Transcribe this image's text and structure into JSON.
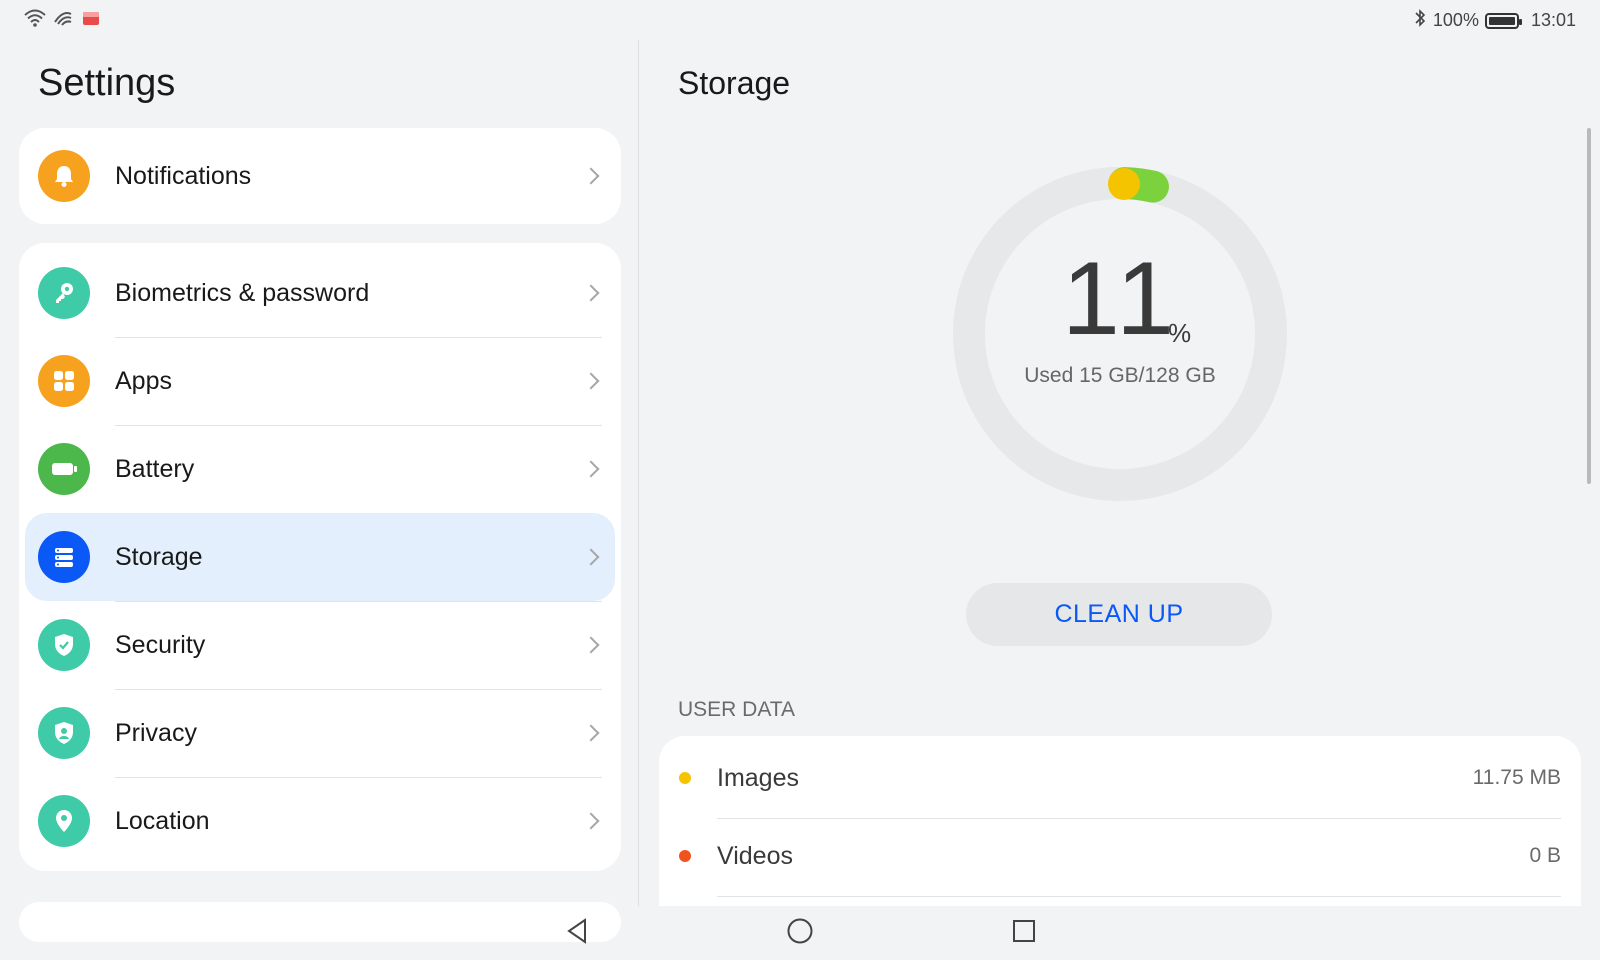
{
  "status_bar": {
    "battery_percent": "100%",
    "time": "13:01",
    "icons": [
      "wifi-icon",
      "signal-icon",
      "app-notification-icon",
      "bluetooth-icon",
      "battery-icon"
    ]
  },
  "settings": {
    "title": "Settings",
    "notifications": {
      "label": "Notifications",
      "icon": "bell-icon",
      "color": "#f7a21e"
    },
    "items": [
      {
        "label": "Biometrics & password",
        "icon": "key-icon",
        "color": "#3fcba8"
      },
      {
        "label": "Apps",
        "icon": "apps-grid-icon",
        "color": "#f7a21e"
      },
      {
        "label": "Battery",
        "icon": "battery-icon",
        "color": "#4cb84c"
      },
      {
        "label": "Storage",
        "icon": "storage-icon",
        "color": "#0a59f7"
      },
      {
        "label": "Security",
        "icon": "shield-check-icon",
        "color": "#3fcba8"
      },
      {
        "label": "Privacy",
        "icon": "privacy-icon",
        "color": "#3fcba8"
      },
      {
        "label": "Location",
        "icon": "location-pin-icon",
        "color": "#3fcba8"
      }
    ]
  },
  "storage": {
    "title": "Storage",
    "percent": "11",
    "percent_sign": "%",
    "used_text": "Used 15 GB/128 GB",
    "used_fraction": 0.11,
    "cleanup_label": "CLEAN UP",
    "user_data_header": "USER DATA",
    "user_data": [
      {
        "label": "Images",
        "value": "11.75 MB",
        "color": "#f5c400"
      },
      {
        "label": "Videos",
        "value": "0 B",
        "color": "#f0541e"
      }
    ]
  },
  "nav": {
    "icons": [
      "back-icon",
      "home-icon",
      "recents-icon"
    ]
  },
  "colors": {
    "accent": "#0a59f7",
    "selected_bg": "#e3effd",
    "page_bg": "#f1f3f5"
  }
}
